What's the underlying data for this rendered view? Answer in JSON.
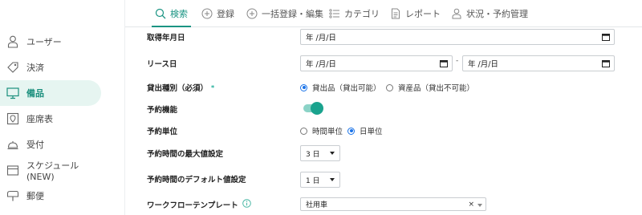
{
  "sidebar": {
    "items": [
      {
        "label": "ユーザー",
        "icon": "user-icon"
      },
      {
        "label": "決済",
        "icon": "tag-icon"
      },
      {
        "label": "備品",
        "icon": "monitor-icon",
        "active": true
      },
      {
        "label": "座席表",
        "icon": "map-pin-icon"
      },
      {
        "label": "受付",
        "icon": "bell-icon"
      },
      {
        "label": "スケジュール(NEW)",
        "icon": "calendar-icon"
      },
      {
        "label": "郵便",
        "icon": "mailbox-icon"
      }
    ]
  },
  "nav": {
    "tabs": [
      {
        "label": "検索",
        "icon": "search-icon",
        "active": true
      },
      {
        "label": "登録",
        "icon": "plus-circle-icon"
      },
      {
        "label": "一括登録・編集",
        "icon": "plus-circle-icon"
      },
      {
        "label": "カテゴリ",
        "icon": "list-icon"
      },
      {
        "label": "レポート",
        "icon": "document-icon"
      },
      {
        "label": "状況・予約管理",
        "icon": "person-icon"
      }
    ]
  },
  "form": {
    "acquisition_date": {
      "label": "取得年月日",
      "value": "年 /月/日"
    },
    "lease_date": {
      "label": "リース日",
      "from": "年 /月/日",
      "separator": "-",
      "to": "年 /月/日"
    },
    "loan_type": {
      "label": "貸出種別（必須）",
      "required_mark": "*",
      "options": [
        "貸出品（貸出可能）",
        "資産品（貸出不可能）"
      ],
      "selected": 0
    },
    "reservation_feature": {
      "label": "予約機能",
      "enabled": true
    },
    "reservation_unit": {
      "label": "予約単位",
      "options": [
        "時間単位",
        "日単位"
      ],
      "selected": 1
    },
    "max_reservation": {
      "label": "予約時間の最大値設定",
      "value": "3 日"
    },
    "default_reservation": {
      "label": "予約時間のデフォルト値設定",
      "value": "1 日"
    },
    "workflow_template": {
      "label": "ワークフローテンプレート",
      "value": "社用車",
      "clear": "×"
    }
  },
  "colors": {
    "accent": "#1a9483",
    "active_bg": "#e6f5f1",
    "radio_selected": "#1a73e8"
  }
}
